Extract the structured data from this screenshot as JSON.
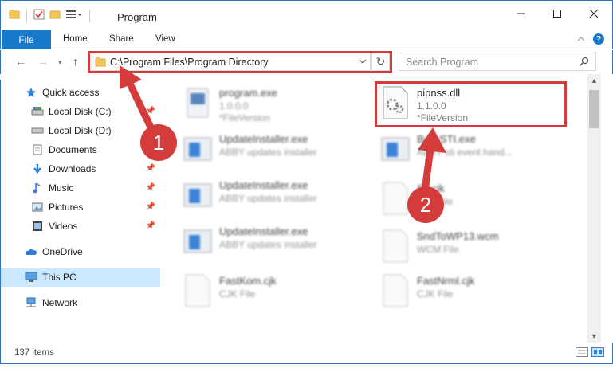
{
  "window": {
    "title": "Program",
    "minimize_icon": "minimize-icon",
    "maximize_icon": "maximize-icon",
    "close_icon": "close-icon"
  },
  "ribbon": {
    "tabs": [
      {
        "label": "File",
        "active": true
      },
      {
        "label": "Home"
      },
      {
        "label": "Share"
      },
      {
        "label": "View"
      }
    ]
  },
  "address_bar": {
    "path": "C:\\Program Files\\Program Directory"
  },
  "search": {
    "placeholder": "Search Program"
  },
  "sidebar": {
    "items": [
      {
        "label": "Quick access",
        "icon": "star-icon"
      },
      {
        "label": "Local Disk (C:)",
        "icon": "drive-icon"
      },
      {
        "label": "Local Disk (D:)",
        "icon": "drive-icon"
      },
      {
        "label": "Documents",
        "icon": "documents-icon"
      },
      {
        "label": "Downloads",
        "icon": "download-icon"
      },
      {
        "label": "Music",
        "icon": "music-icon"
      },
      {
        "label": "Pictures",
        "icon": "pictures-icon"
      },
      {
        "label": "Videos",
        "icon": "videos-icon"
      },
      {
        "label": "OneDrive",
        "icon": "cloud-icon"
      },
      {
        "label": "This PC",
        "icon": "computer-icon",
        "selected": true
      },
      {
        "label": "Network",
        "icon": "network-icon"
      }
    ]
  },
  "files": {
    "left": [
      {
        "name": "program.exe",
        "line2": "1.0.0.0",
        "line3": "*FileVersion"
      },
      {
        "name": "UpdateInstaller.exe",
        "line2": "ABBY updates installer",
        "line3": ""
      },
      {
        "name": "UpdateInstaller.exe",
        "line2": "ABBY updates installer",
        "line3": ""
      },
      {
        "name": "UpdateInstaller.exe",
        "line2": "ABBY updates installer",
        "line3": ""
      },
      {
        "name": "FastKom.cjk",
        "line2": "CJK File",
        "line3": ""
      }
    ],
    "right": [
      {
        "name": "pipnss.dll",
        "line2": "1.1.0.0",
        "line3": "*FileVersion",
        "highlight": true
      },
      {
        "name": "BuyySTI.exe",
        "line2": "ABBY sti event hand...",
        "line3": ""
      },
      {
        "name": "Sfi.cjk",
        "line2": "CJK File",
        "line3": ""
      },
      {
        "name": "SndToWP13.wcm",
        "line2": "WCM File",
        "line3": ""
      },
      {
        "name": "FastNrml.cjk",
        "line2": "CJK File",
        "line3": ""
      }
    ]
  },
  "status": {
    "item_count": "137 items"
  },
  "annotations": {
    "badge1": "1",
    "badge2": "2",
    "color": "#d43b3b"
  },
  "colors": {
    "accent": "#1979ca",
    "selected_bg": "#cce8ff",
    "highlight": "#d43b3b"
  }
}
